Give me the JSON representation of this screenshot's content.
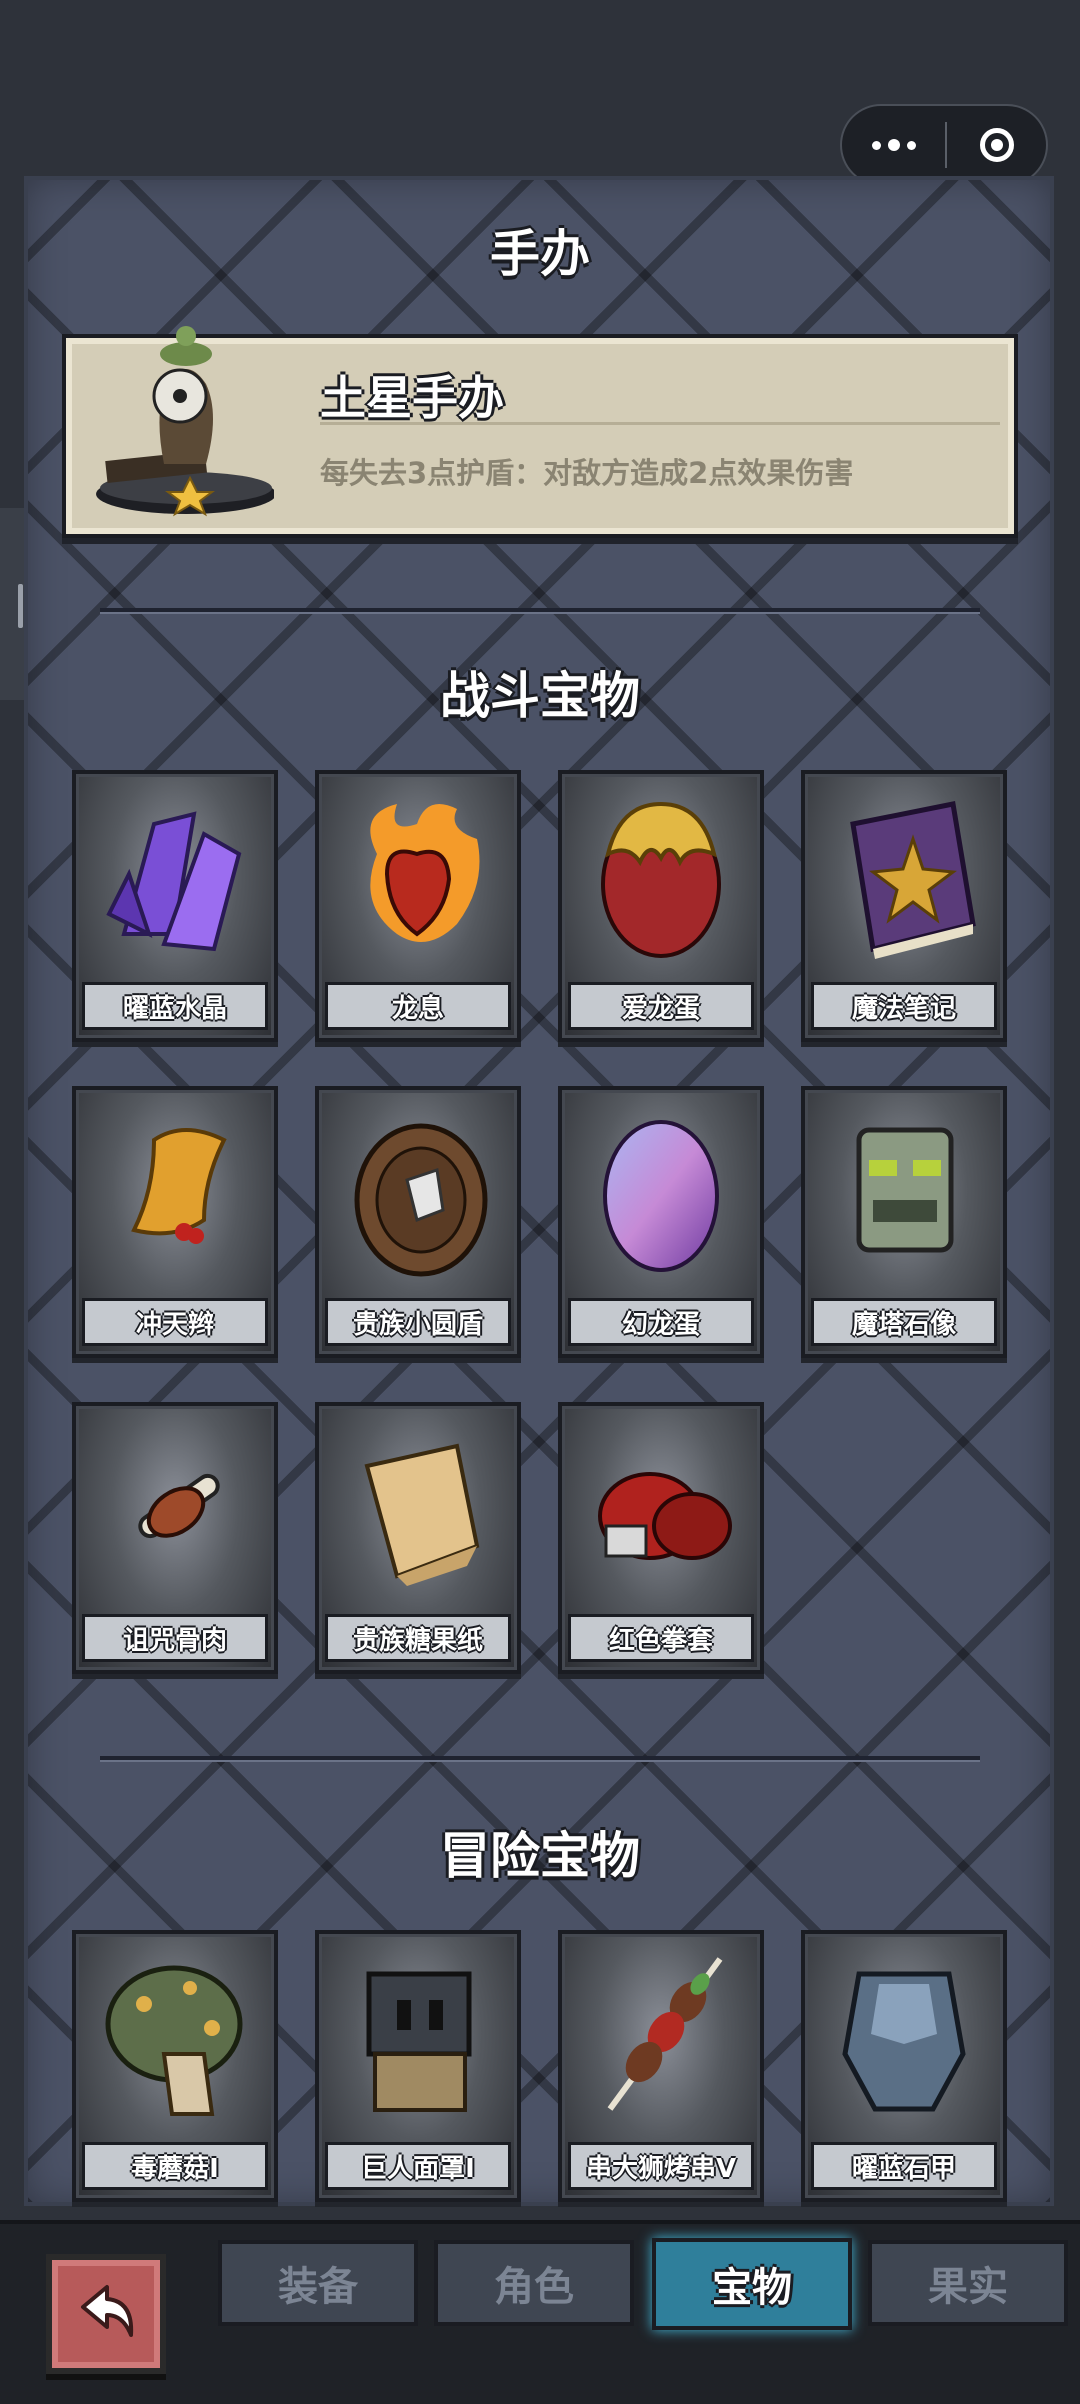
{
  "capsule": {
    "more_icon": "more-dots-icon",
    "close_icon": "target-circle-icon"
  },
  "figure_section": {
    "title": "手办",
    "item": {
      "name": "土星手办",
      "description": "每失去3点护盾：对敌方造成2点效果伤害"
    }
  },
  "battle_section": {
    "title": "战斗宝物",
    "items": [
      {
        "name": "曜蓝水晶"
      },
      {
        "name": "龙息"
      },
      {
        "name": "爱龙蛋"
      },
      {
        "name": "魔法笔记"
      },
      {
        "name": "冲天辫"
      },
      {
        "name": "贵族小圆盾"
      },
      {
        "name": "幻龙蛋"
      },
      {
        "name": "魔塔石像"
      },
      {
        "name": "诅咒骨肉"
      },
      {
        "name": "贵族糖果纸"
      },
      {
        "name": "红色拳套"
      }
    ]
  },
  "adventure_section": {
    "title": "冒险宝物",
    "items": [
      {
        "name": "毒蘑菇I"
      },
      {
        "name": "巨人面罩I"
      },
      {
        "name": "串大狮烤串V"
      },
      {
        "name": "曜蓝石甲"
      }
    ]
  },
  "bottom_nav": {
    "back_icon": "back-arrow-icon",
    "tabs": [
      {
        "label": "装备"
      },
      {
        "label": "角色"
      },
      {
        "label": "宝物"
      },
      {
        "label": "果实"
      }
    ],
    "active_tab": "宝物"
  },
  "colors": {
    "active_tab": "#2f7f9b",
    "panel": "#4b5266",
    "card": "#d4cdb7"
  }
}
